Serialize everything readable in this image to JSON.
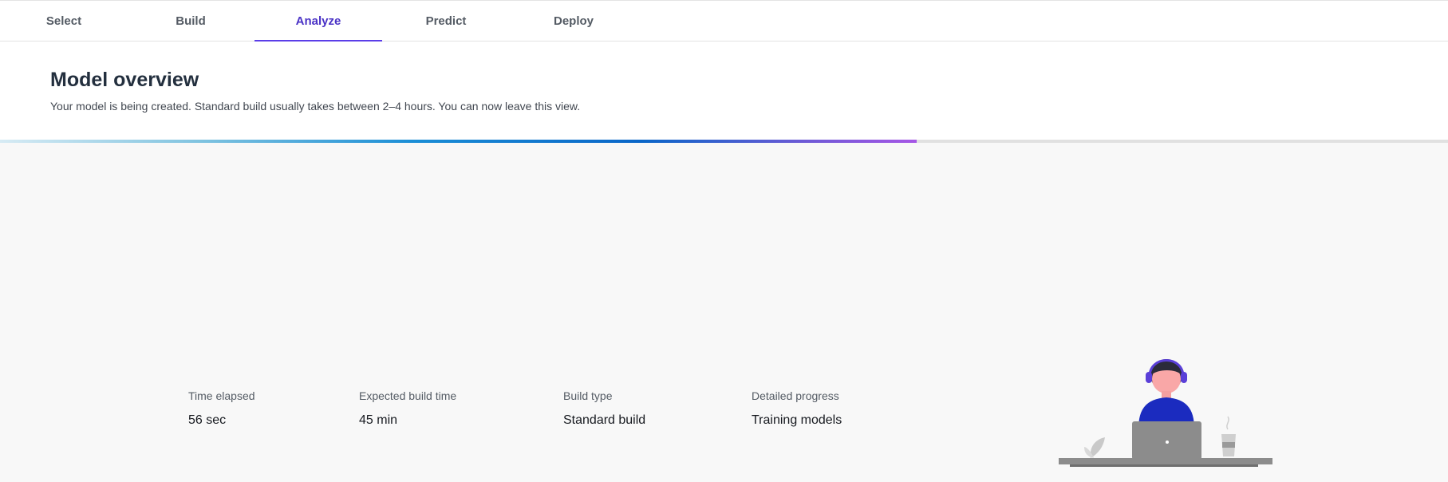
{
  "tabs": [
    {
      "label": "Select",
      "active": false
    },
    {
      "label": "Build",
      "active": false
    },
    {
      "label": "Analyze",
      "active": true
    },
    {
      "label": "Predict",
      "active": false
    },
    {
      "label": "Deploy",
      "active": false
    }
  ],
  "overview": {
    "title": "Model overview",
    "subtitle": "Your model is being created. Standard build usually takes between 2–4 hours. You can now leave this view."
  },
  "progress": {
    "fraction": 0.633
  },
  "metrics": [
    {
      "label": "Time elapsed",
      "value": "56 sec"
    },
    {
      "label": "Expected build time",
      "value": "45 min"
    },
    {
      "label": "Build type",
      "value": "Standard build"
    },
    {
      "label": "Detailed progress",
      "value": "Training models"
    }
  ],
  "colors": {
    "accent": "#4a32c6",
    "shirt": "#1b2bbf",
    "laptop": "#8c8c8c"
  },
  "illustration": {
    "icon": "person-at-laptop-illustration"
  }
}
